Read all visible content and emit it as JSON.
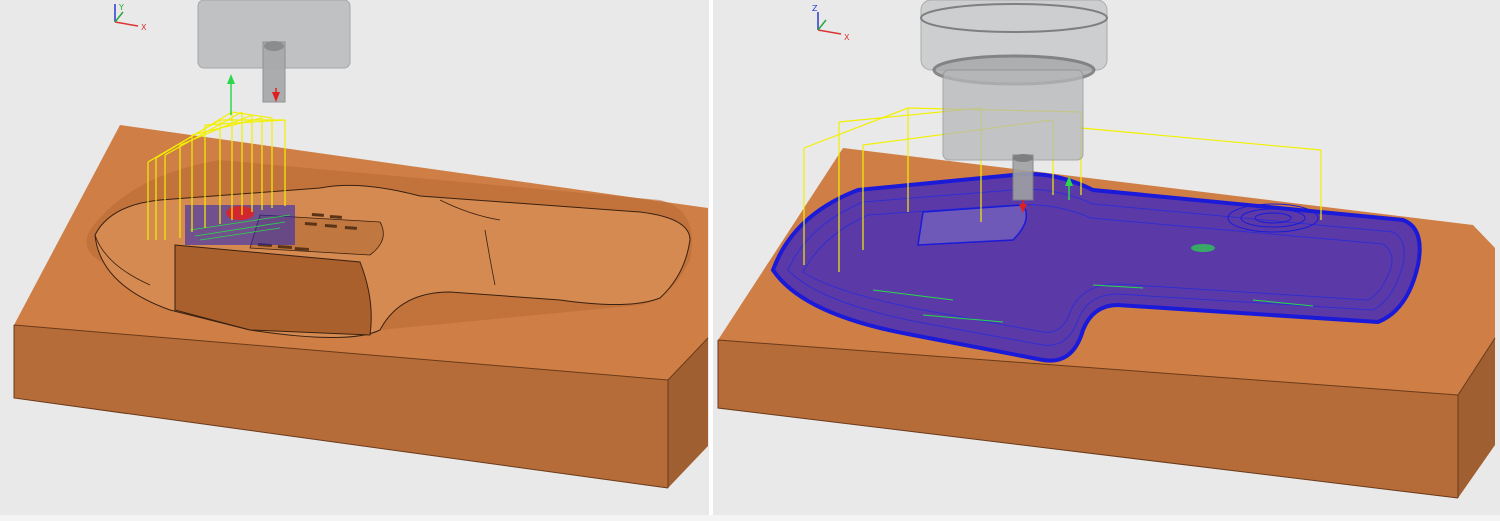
{
  "viewports": [
    {
      "id": "left",
      "view_cube_axes": {
        "x": "X",
        "y": "Y",
        "z": "Z"
      }
    },
    {
      "id": "right",
      "view_cube_axes": {
        "x": "X",
        "y": "Y",
        "z": "Z"
      }
    }
  ],
  "colors": {
    "stock_top": "#cf7f45",
    "stock_front": "#b56c38",
    "stock_side": "#a05f31",
    "toolpath_yellow": "#f2f000",
    "toolpath_blue": "#1a1ad8",
    "toolpath_green": "#2ad94a",
    "retract_red": "#e02020",
    "tool_gray": "#b4b6b8",
    "background": "#e9e9e9"
  }
}
